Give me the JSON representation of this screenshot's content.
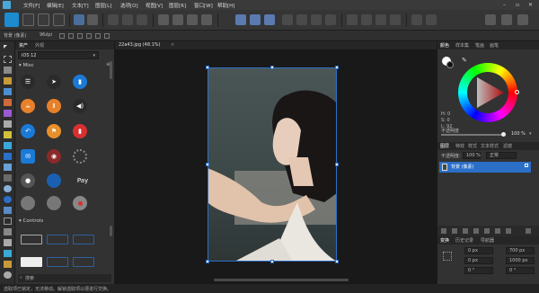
{
  "menu": {
    "items": [
      "文件[F]",
      "编辑[E]",
      "文本[T]",
      "图层[L]",
      "选项[O]",
      "视图[V]",
      "图层[R]",
      "窗口[W]",
      "帮助[H]"
    ]
  },
  "context": {
    "label": "背景 (像素)",
    "dpi": "96dpi"
  },
  "assets": {
    "tabs": [
      "资产",
      "外观"
    ],
    "dropdown": "iOS 12",
    "section_misc": "Misc",
    "section_controls": "Controls",
    "search_placeholder": "搜索"
  },
  "document": {
    "tab_title": "22a43.jpg (48.1%)"
  },
  "right": {
    "tabs_top": [
      "颜色",
      "样本集",
      "笔画",
      "画笔"
    ],
    "hsl": {
      "h": "H: 0",
      "s": "S: 0",
      "l": "L: 92"
    },
    "opacity_label": "不透明度",
    "opacity_value": "100 %",
    "tabs_mid": [
      "图层",
      "特效",
      "样式",
      "文本样式",
      "滤镜"
    ],
    "layer_opacity_label": "不透明度:",
    "layer_opacity_value": "100 %",
    "blend_mode": "正常",
    "layer_name": "背景 (像素)",
    "tabs_bottom": [
      "变换",
      "历史记录",
      "导航器"
    ],
    "fields": [
      "0 px",
      "700 px",
      "0 px",
      "1000 px",
      "0 °",
      "0 °"
    ]
  },
  "status": "选取项已锁定，无法移动。解锁选取项以便进行交换。",
  "colors": {
    "accent": "#2b6fc7",
    "panel": "#323232",
    "canvas": "#191919"
  }
}
